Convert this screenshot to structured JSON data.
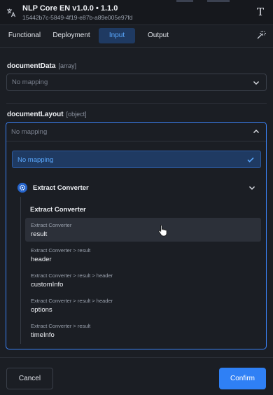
{
  "header": {
    "title": "NLP Core EN v1.0.0 • 1.1.0",
    "subtitle": "15442b7c-5849-4f19-e87b-a89e005e97fd",
    "left_icon": "translate-icon",
    "right_icon": "text-type-icon"
  },
  "tabs": [
    {
      "label": "Functional",
      "active": false
    },
    {
      "label": "Deployment",
      "active": false
    },
    {
      "label": "Input",
      "active": true
    },
    {
      "label": "Output",
      "active": false
    }
  ],
  "tabs_right_icon": "magic-wand-icon",
  "fields": [
    {
      "name": "documentData",
      "type": "[array]",
      "value": "No mapping"
    },
    {
      "name": "documentLayout",
      "type": "[object]",
      "value": "No mapping"
    }
  ],
  "dropdown": {
    "selected_option": "No mapping",
    "group": {
      "label": "Extract Converter",
      "icon": "gear-icon",
      "title": "Extract Converter",
      "items": [
        {
          "path": "Extract Converter",
          "name": "result",
          "hovered": true
        },
        {
          "path": "Extract Converter > result",
          "name": "header",
          "hovered": false
        },
        {
          "path": "Extract Converter > result > header",
          "name": "customInfo",
          "hovered": false
        },
        {
          "path": "Extract Converter > result > header",
          "name": "options",
          "hovered": false
        },
        {
          "path": "Extract Converter > result",
          "name": "timeInfo",
          "hovered": false
        }
      ]
    }
  },
  "footer": {
    "cancel_label": "Cancel",
    "confirm_label": "Confirm"
  },
  "colors": {
    "accent": "#2f80f5",
    "selected_bg": "#1f3a62",
    "selected_text": "#5aa9ff",
    "background": "#1b1e24"
  }
}
